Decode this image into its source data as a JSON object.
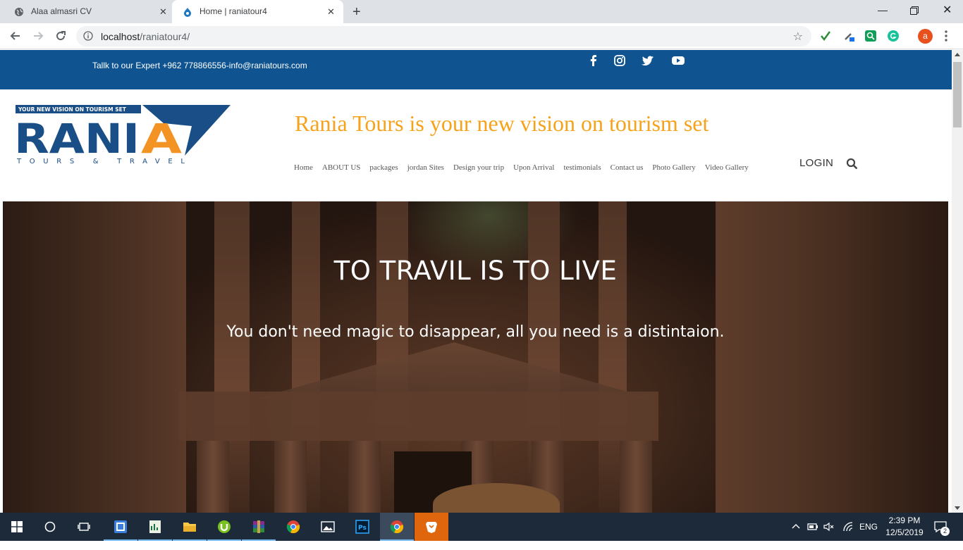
{
  "browser": {
    "tabs": [
      {
        "title": "Alaa almasri CV"
      },
      {
        "title": "Home | raniatour4"
      }
    ],
    "url_host": "localhost",
    "url_path": "/raniatour4/",
    "profile_initial": "a"
  },
  "site": {
    "contact_text": "Tallk to our Expert +962 778866556-info@raniatours.com",
    "social": [
      "facebook-icon",
      "instagram-icon",
      "twitter-icon",
      "youtube-icon"
    ],
    "logo": {
      "top_text": "YOUR NEW VISION ON TOURISM SET",
      "name_blue": "RANI",
      "name_orange": "A",
      "sub_text": "TOURS & TRAVEL"
    },
    "tagline": "Rania Tours is your new vision on tourism set",
    "nav": [
      {
        "label": "Home"
      },
      {
        "label": "ABOUT US"
      },
      {
        "label": "packages"
      },
      {
        "label": "jordan Sites"
      },
      {
        "label": "Design your trip"
      },
      {
        "label": "Upon Arrival"
      },
      {
        "label": "testimonials"
      },
      {
        "label": "Contact us"
      },
      {
        "label": "Photo Gallery"
      },
      {
        "label": "Video Gallery"
      }
    ],
    "login_label": "LOGIN",
    "hero": {
      "heading": "TO TRAVIL IS TO LIVE",
      "subheading": "You don't need magic to disappear, all you need is a distintaion."
    },
    "colors": {
      "topbar": "#0f5490",
      "tagline": "#f7a21b",
      "logo_blue": "#1a4e86",
      "logo_orange": "#f39323"
    }
  },
  "taskbar": {
    "apps": [
      "task-view",
      "app-blue-square",
      "excel-like",
      "file-explorer",
      "utorrent",
      "winrar",
      "chrome",
      "photos",
      "photoshop",
      "chrome-active",
      "brave"
    ],
    "language": "ENG",
    "time": "2:39 PM",
    "date": "12/5/2019",
    "notifications": "2"
  }
}
